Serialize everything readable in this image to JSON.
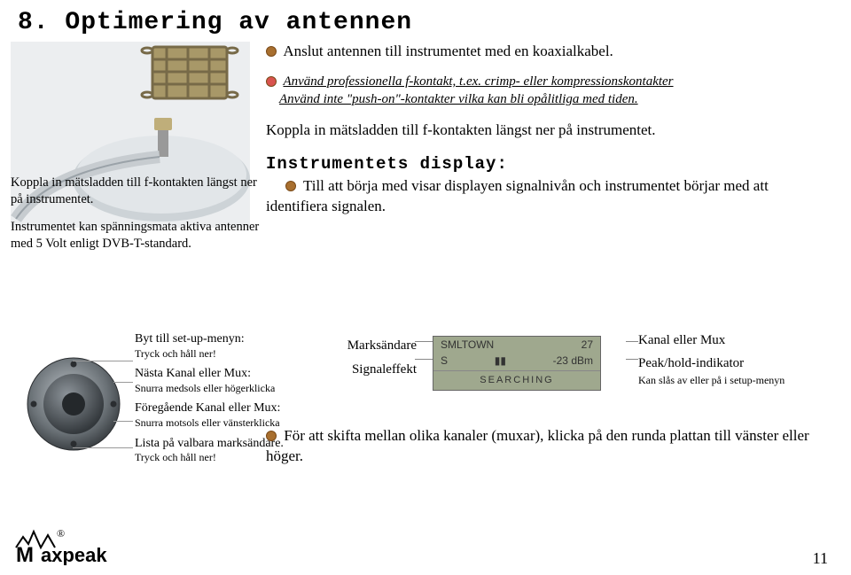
{
  "title": "8. Optimering av antennen",
  "intro": "Anslut antennen till instrumentet med en koaxialkabel.",
  "warning": {
    "line1": "Använd professionella f-kontakt, t.ex. crimp- eller kompressionskontakter",
    "line2": "Använd inte \"push-on\"-kontakter vilka kan bli opålitliga med tiden."
  },
  "koppla": "Koppla in mätsladden till f-kontakten längst ner på instrumentet.",
  "display_heading": "Instrumentets display:",
  "display_body": "Till att börja med visar displayen signalnivån och instrumentet börjar med att identifiera signalen.",
  "left_para1": "Koppla in mätsladden till f-kontakten längst ner på instrumentet.",
  "left_para2": "Instrumentet kan spänningsmata aktiva antenner med 5 Volt enligt DVB-T-standard.",
  "dial": {
    "setup": {
      "head": "Byt till set-up-menyn:",
      "sub": "Tryck och håll ner!"
    },
    "next": {
      "head": "Nästa Kanal eller Mux:",
      "sub": "Snurra medsols eller högerklicka"
    },
    "prev": {
      "head": "Föregående Kanal eller Mux:",
      "sub": "Snurra motsols eller vänsterklicka"
    },
    "list": {
      "head": "Lista på valbara marksändare.",
      "sub": "Tryck och håll ner!"
    }
  },
  "lcd": {
    "row1_left": "SMLTOWN",
    "row1_right": "27",
    "row2_left": "S",
    "row2_right": "-23 dBm",
    "row2_mid_bar": "▮▮",
    "search": "SEARCHING"
  },
  "lcd_labels": {
    "left_top": "Marksändare",
    "left_bot": "Signaleffekt",
    "right_top": "Kanal eller Mux",
    "right_bot": "Peak/hold-indikator",
    "right_bot_sub": "Kan slås av eller på i setup-menyn"
  },
  "lower_para": "För att skifta mellan olika kanaler (muxar), klicka på den runda plattan till vänster eller höger.",
  "logo_text": "axpeak",
  "page_number": "11"
}
